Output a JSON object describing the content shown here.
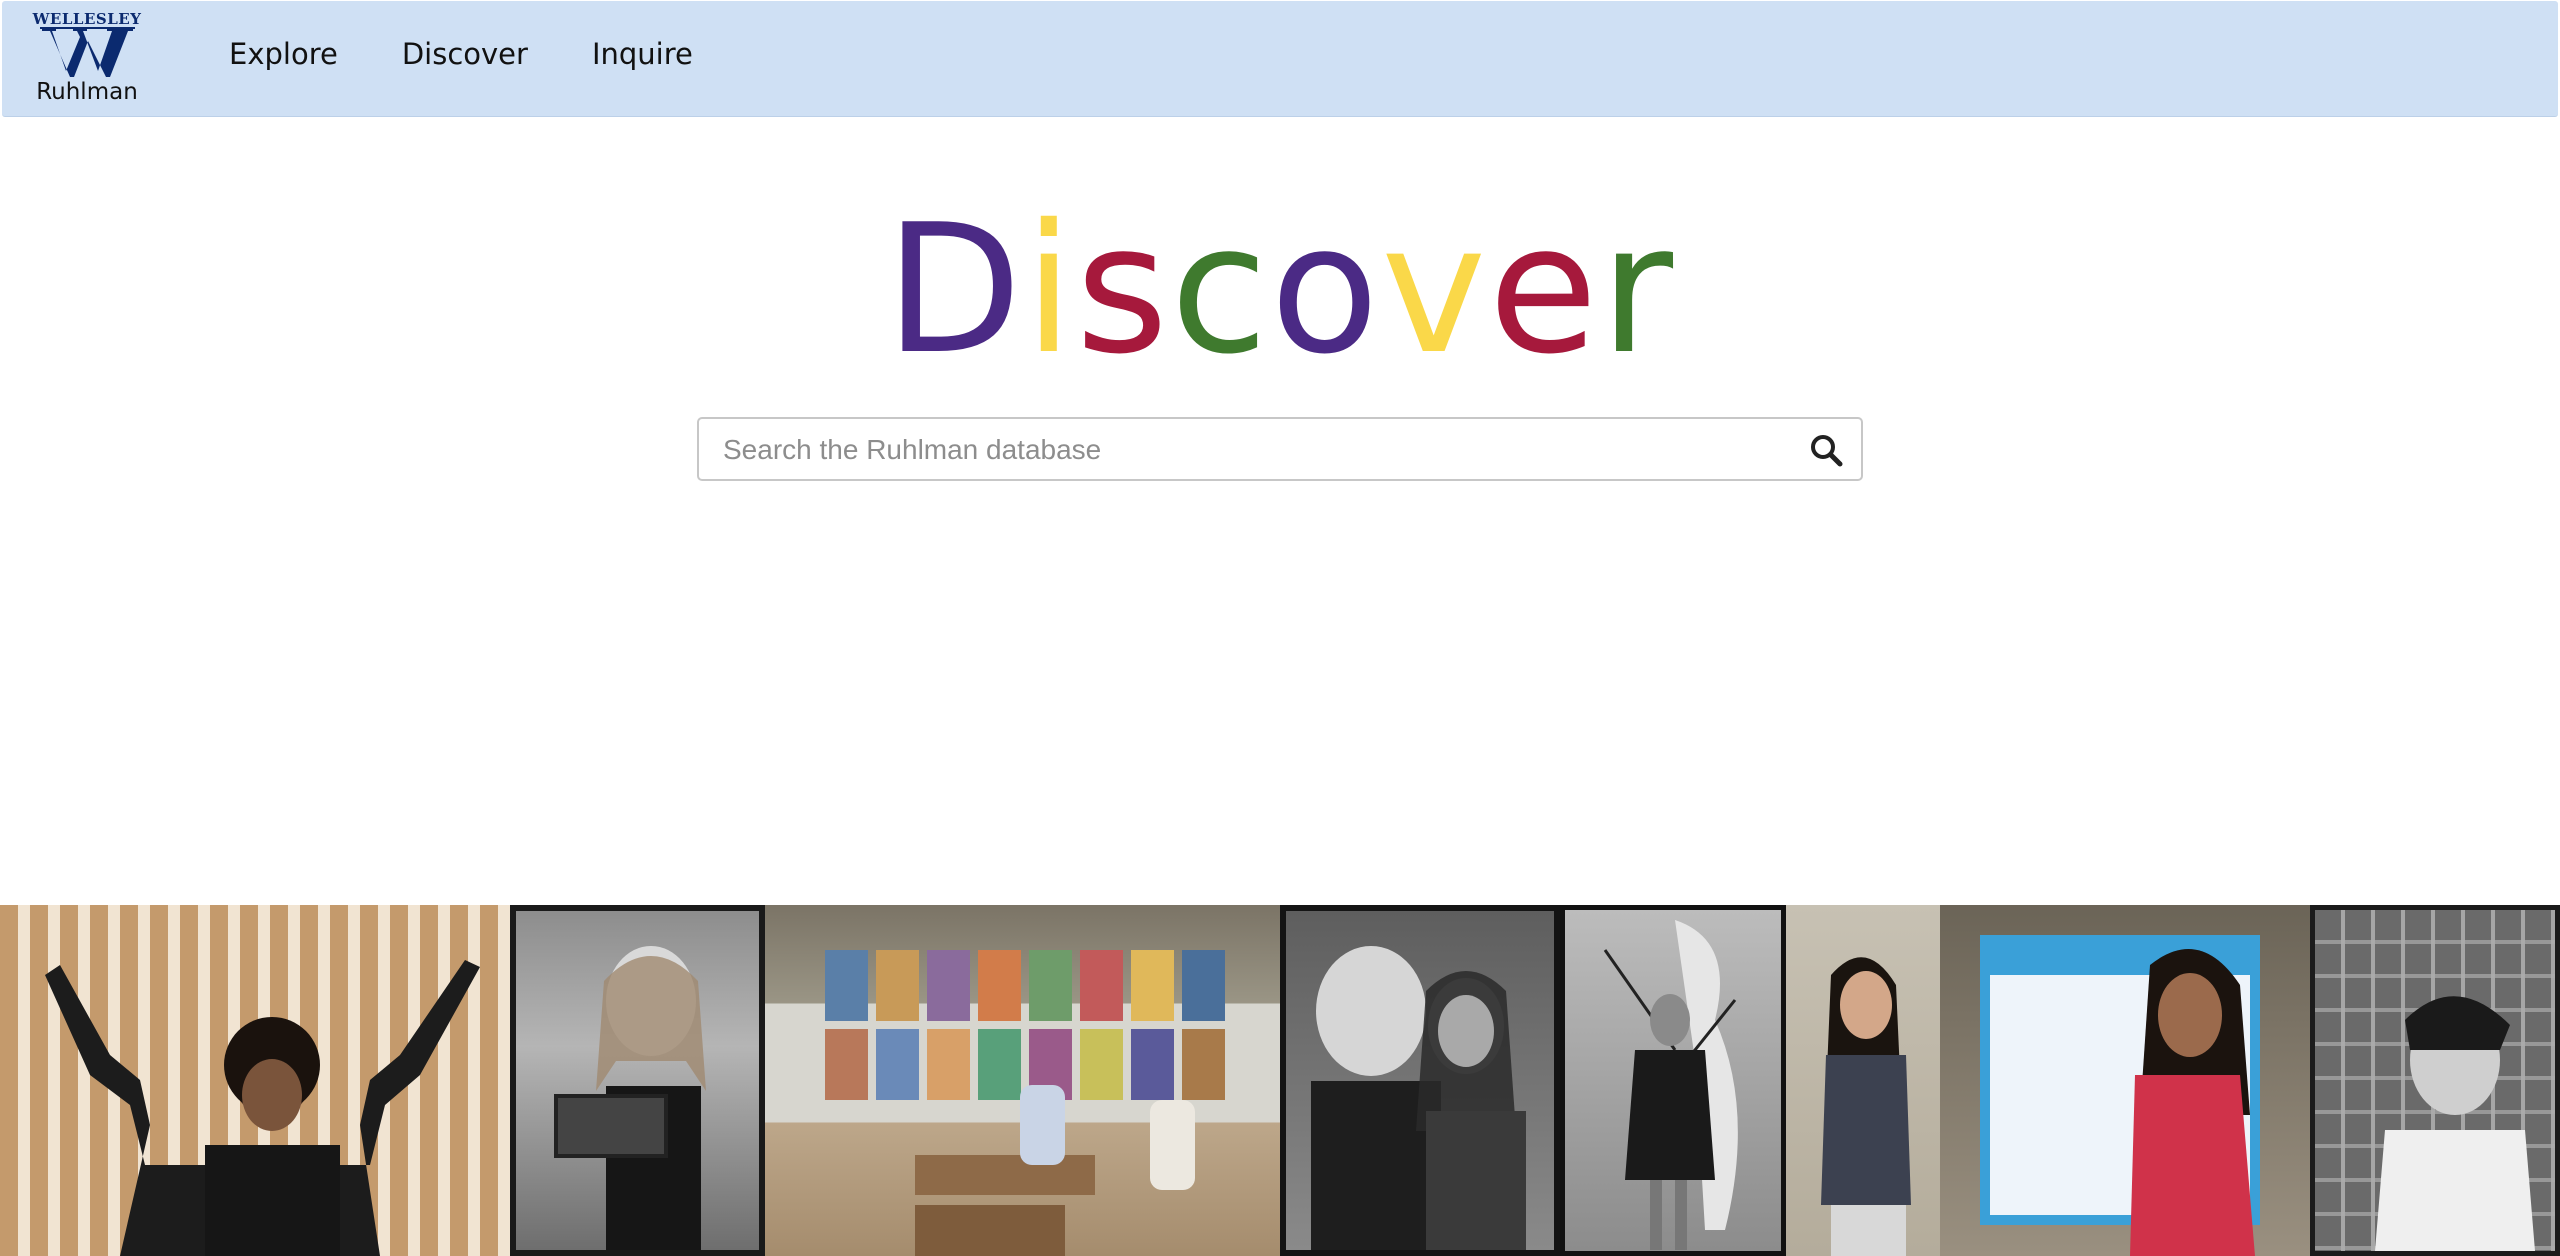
{
  "nav": {
    "logo_top": "WELLESLEY",
    "logo_bottom": "Ruhlman",
    "links": [
      "Explore",
      "Discover",
      "Inquire"
    ]
  },
  "hero": {
    "letters": [
      {
        "char": "D",
        "color": "#4b2a85"
      },
      {
        "char": "i",
        "color": "#fad849"
      },
      {
        "char": "s",
        "color": "#a6193c"
      },
      {
        "char": "c",
        "color": "#3f7a2e"
      },
      {
        "char": "o",
        "color": "#4b2a85"
      },
      {
        "char": "v",
        "color": "#fad849"
      },
      {
        "char": "e",
        "color": "#a6193c"
      },
      {
        "char": "r",
        "color": "#3f7a2e"
      }
    ]
  },
  "search": {
    "placeholder": "Search the Ruhlman database",
    "value": "",
    "icon": "search-icon"
  },
  "photos": [
    {
      "name": "photo-student-arms-raised",
      "tone": "color"
    },
    {
      "name": "photo-student-with-robot",
      "tone": "bw"
    },
    {
      "name": "photo-art-exhibit",
      "tone": "color"
    },
    {
      "name": "photo-two-women-talking",
      "tone": "bw"
    },
    {
      "name": "photo-woman-with-sculpture",
      "tone": "bw"
    },
    {
      "name": "photo-student-presenting",
      "tone": "color"
    },
    {
      "name": "photo-poster-presenter",
      "tone": "color"
    },
    {
      "name": "photo-portrait-wall",
      "tone": "bw"
    }
  ]
}
